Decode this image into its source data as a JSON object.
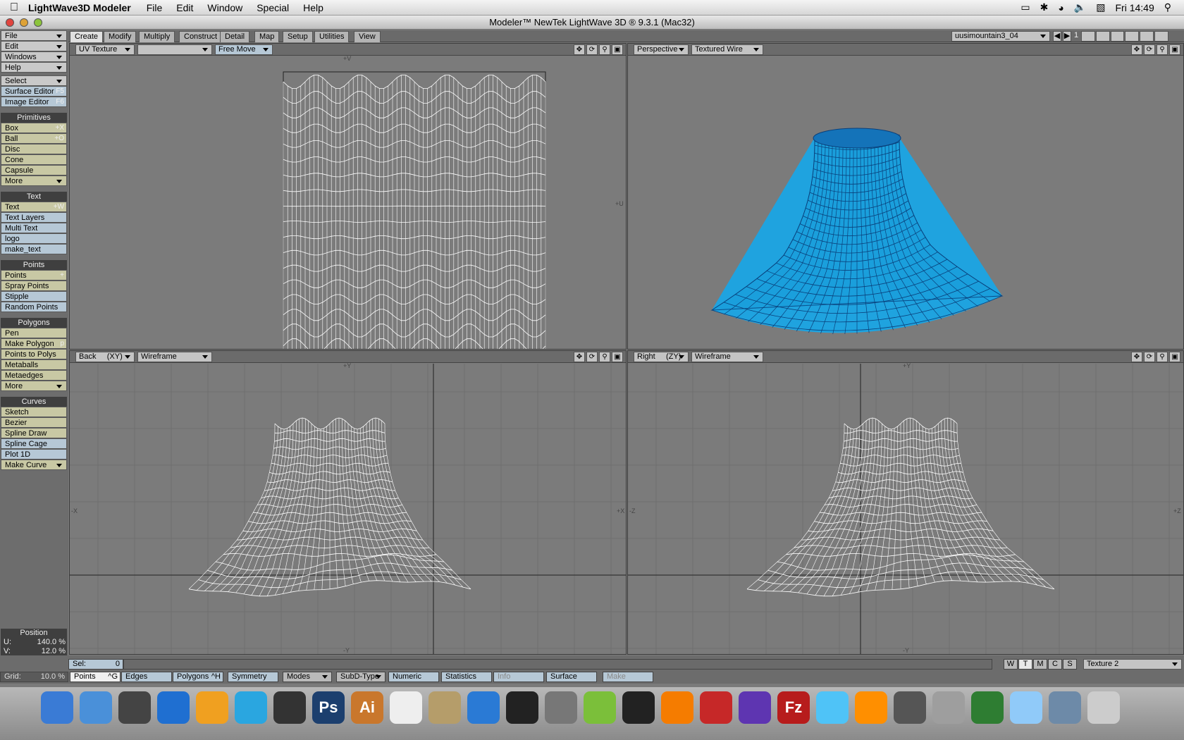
{
  "menubar": {
    "app_name": "LightWave3D Modeler",
    "items": [
      "File",
      "Edit",
      "Window",
      "Special",
      "Help"
    ],
    "clock": "Fri 14:49"
  },
  "window": {
    "title": "Modeler™ NewTek LightWave 3D ® 9.3.1 (Mac32)"
  },
  "sidebar": {
    "top": [
      {
        "label": "File"
      },
      {
        "label": "Edit"
      },
      {
        "label": "Windows"
      },
      {
        "label": "Help"
      }
    ],
    "select": {
      "label": "Select"
    },
    "surface_editor": {
      "label": "Surface Editor",
      "shortcut": "F5"
    },
    "image_editor": {
      "label": "Image Editor",
      "shortcut": "F6"
    },
    "primitives_header": "Primitives",
    "primitives": [
      {
        "label": "Box",
        "shortcut": "+X"
      },
      {
        "label": "Ball",
        "shortcut": "+O"
      },
      {
        "label": "Disc",
        "shortcut": ""
      },
      {
        "label": "Cone",
        "shortcut": ""
      },
      {
        "label": "Capsule",
        "shortcut": ""
      },
      {
        "label": "More",
        "shortcut": ""
      }
    ],
    "text_header": "Text",
    "text": [
      {
        "label": "Text",
        "shortcut": "+W"
      },
      {
        "label": "Text Layers"
      },
      {
        "label": "Multi Text"
      },
      {
        "label": "logo"
      },
      {
        "label": "make_text"
      }
    ],
    "points_header": "Points",
    "points": [
      {
        "label": "Points",
        "shortcut": "+"
      },
      {
        "label": "Spray Points"
      },
      {
        "label": "Stipple"
      },
      {
        "label": "Random Points"
      }
    ],
    "polygons_header": "Polygons",
    "polygons": [
      {
        "label": "Pen"
      },
      {
        "label": "Make Polygon",
        "shortcut": "p"
      },
      {
        "label": "Points to Polys"
      },
      {
        "label": "Metaballs"
      },
      {
        "label": "Metaedges"
      },
      {
        "label": "More"
      }
    ],
    "curves_header": "Curves",
    "curves": [
      {
        "label": "Sketch"
      },
      {
        "label": "Bezier"
      },
      {
        "label": "Spline Draw"
      },
      {
        "label": "Spline Cage"
      },
      {
        "label": "Plot 1D"
      },
      {
        "label": "Make Curve"
      }
    ],
    "position": {
      "header": "Position",
      "u_label": "U:",
      "u_value": "140.0 %",
      "v_label": "V:",
      "v_value": "12.0 %"
    }
  },
  "tabs": [
    "Create",
    "Modify",
    "Multiply",
    "Construct",
    "Detail",
    "Map",
    "Setup",
    "Utilities",
    "View"
  ],
  "object_selector": "uusimountain3_04",
  "layer_num": "1",
  "viewports": {
    "tl": {
      "view": "UV Texture",
      "map": "",
      "tool": "Free Move",
      "axis_top": "+V",
      "axis_right": "+U"
    },
    "tr": {
      "view": "Perspective",
      "mode": "Textured Wire"
    },
    "bl": {
      "view": "Back",
      "axes": "(XY)",
      "mode": "Wireframe",
      "ax_top": "+Y",
      "ax_left": "-X",
      "ax_right": "+X",
      "ax_bottom": "-Y"
    },
    "br": {
      "view": "Right",
      "axes": "(ZY)",
      "mode": "Wireframe",
      "ax_top": "+Y",
      "ax_left": "-Z",
      "ax_right": "+Z",
      "ax_bottom": "-Y"
    }
  },
  "bottom": {
    "sel_label": "Sel:",
    "sel_value": "0",
    "grid_label": "Grid:",
    "grid_value": "10.0 %",
    "modes": [
      {
        "label": "Points",
        "shortcut": "^G"
      },
      {
        "label": "Edges",
        "shortcut": ""
      },
      {
        "label": "Polygons",
        "shortcut": "^H"
      }
    ],
    "symmetry": "Symmetry",
    "modes_dd": "Modes",
    "subd": "SubD-Type",
    "numeric": "Numeric",
    "statistics": "Statistics",
    "info": "Info",
    "surface": "Surface",
    "make": "Make",
    "wtmcs": [
      "W",
      "T",
      "M",
      "C",
      "S"
    ],
    "texture": "Texture 2"
  },
  "colors": {
    "accent": "#1aa3e0",
    "bg": "#7b7b7b",
    "mesh": "#ffffff"
  },
  "dock": {
    "icons": [
      "finder-icon",
      "ichat-icon",
      "time-icon",
      "safari-icon",
      "maya-icon",
      "skype-icon",
      "backup-icon",
      "photoshop-icon",
      "illustrator-icon",
      "textedit-icon",
      "preview-icon",
      "spiral-icon",
      "sapps-icon",
      "hammer-icon",
      "chat-icon",
      "terminal-icon",
      "vlc-icon",
      "lightwave-icon",
      "lightwave2-icon",
      "filezilla-icon",
      "itunes-icon",
      "photo-icon",
      "star-icon",
      "settings-icon",
      "lw3-icon",
      "folder-icon",
      "docs-icon",
      "trash-icon"
    ],
    "ps": "Ps",
    "ai": "Ai",
    "fz": "Fz"
  }
}
